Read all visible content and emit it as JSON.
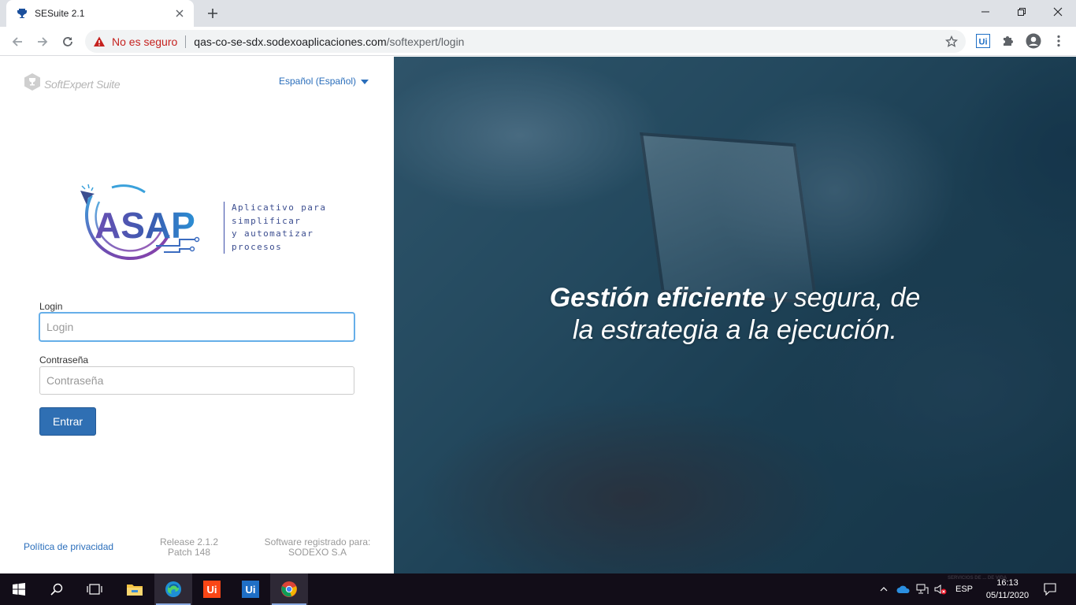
{
  "browser": {
    "tab_title": "SESuite 2.1",
    "not_secure_label": "No es seguro",
    "url_host": "qas-co-se-sdx.sodexoaplicaciones.com",
    "url_path": "/softexpert/login"
  },
  "header": {
    "brand": "SoftExpert Suite",
    "language": "Español (Español)"
  },
  "logo": {
    "name": "ASAP",
    "tagline": [
      "Aplicativo para",
      "simplificar",
      "y automatizar",
      "procesos"
    ]
  },
  "form": {
    "login_label": "Login",
    "login_placeholder": "Login",
    "password_label": "Contraseña",
    "password_placeholder": "Contraseña",
    "submit_label": "Entrar"
  },
  "footer": {
    "privacy": "Política de privacidad",
    "release": "Release 2.1.2",
    "patch": "Patch 148",
    "registered_label": "Software registrado para:",
    "registered_to": "SODEXO S.A"
  },
  "hero": {
    "bold": "Gestión eficiente",
    "rest_line1": " y segura, de",
    "line2": "la estrategia a la ejecución."
  },
  "taskbar": {
    "language": "ESP",
    "time": "16:13",
    "date": "05/11/2020",
    "notice": "SERVICIOS DE ... DE VIDA"
  },
  "colors": {
    "link": "#2a6ebb",
    "primary_button": "#2f6fb3",
    "not_secure": "#c5221f"
  }
}
